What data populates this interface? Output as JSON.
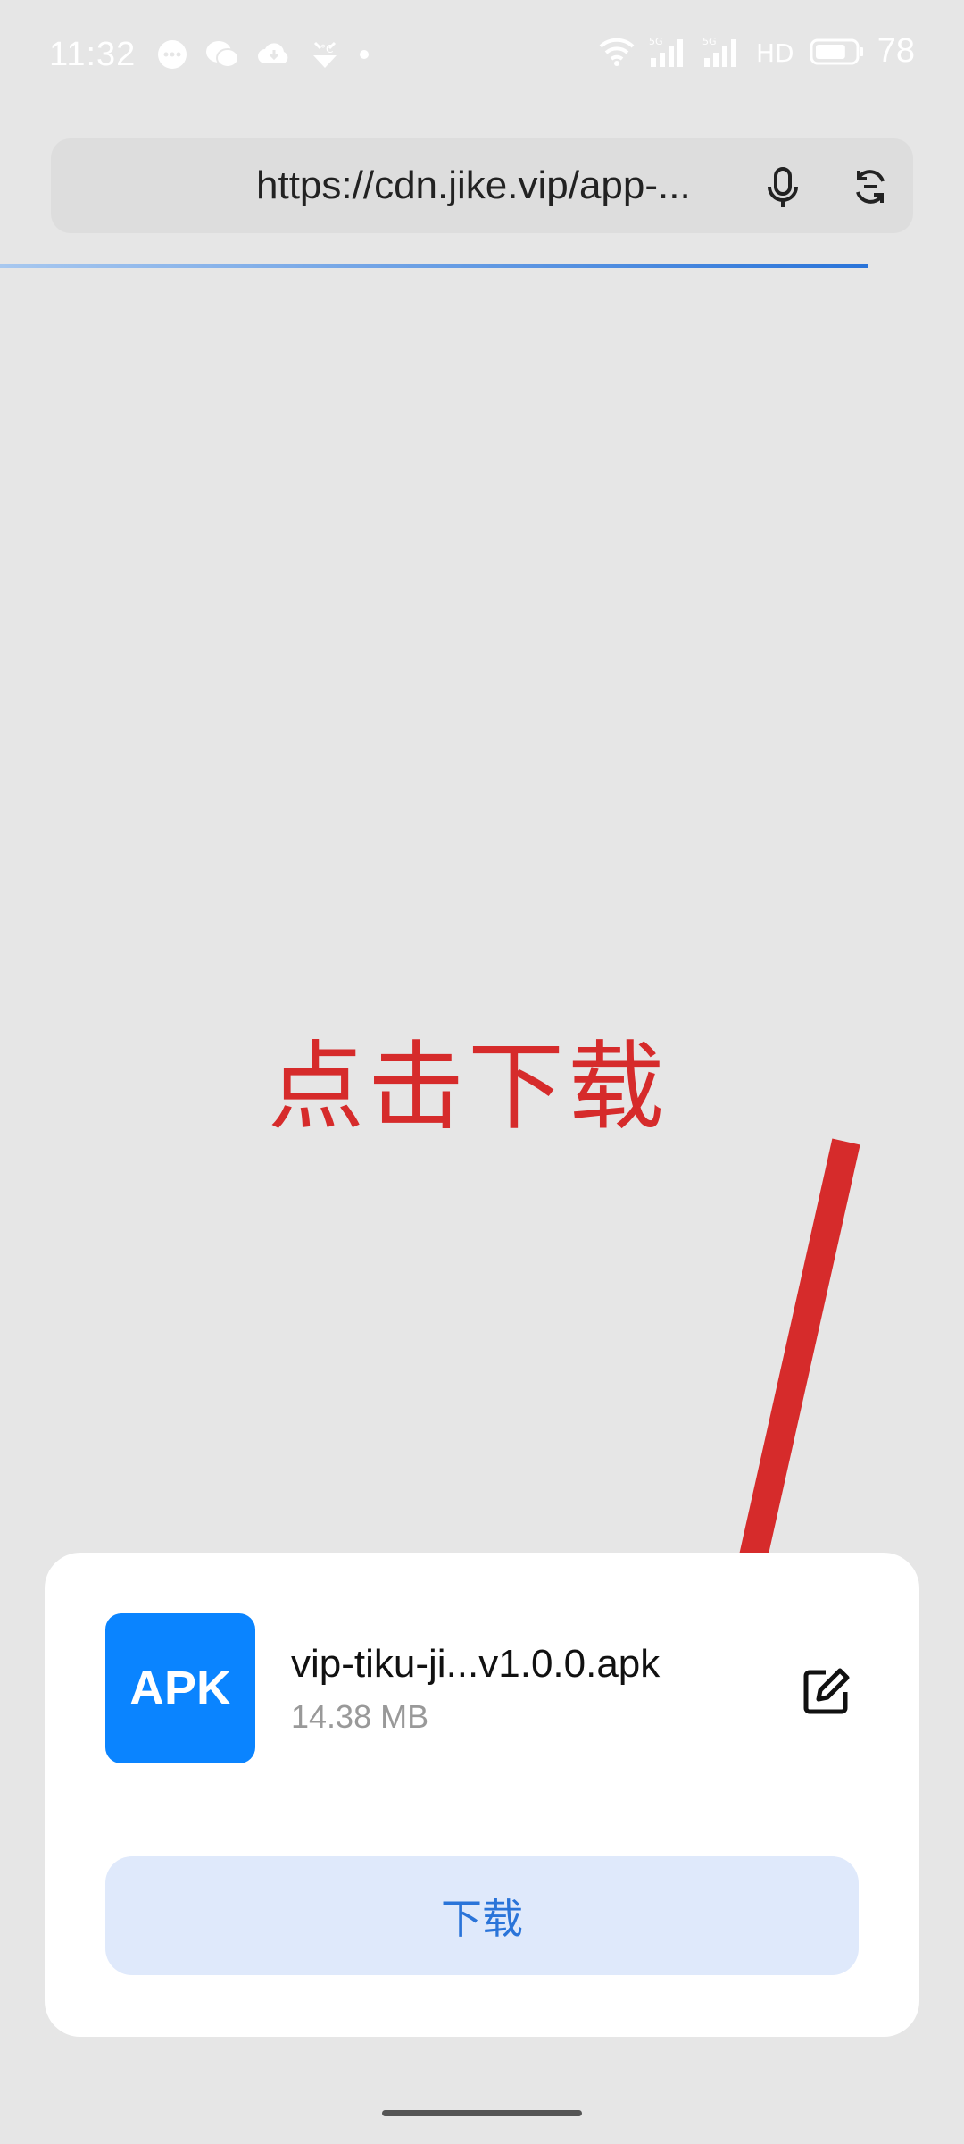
{
  "status_bar": {
    "time": "11:32",
    "left_icons": [
      "message-icon",
      "wechat-icon",
      "cloud-icon",
      "weather-icon",
      "dot-icon"
    ],
    "right_icons": [
      "wifi-icon",
      "signal-5g-icon",
      "signal-5g-icon",
      "hd-icon",
      "battery-icon"
    ],
    "network_label": "5G",
    "hd_label": "HD",
    "battery_level": "78",
    "battery_fraction": 0.78
  },
  "browser": {
    "url": "https://cdn.jike.vip/app-...",
    "mic_icon": "microphone-icon",
    "sync_icon": "sync-icon",
    "load_progress": 0.9
  },
  "annotation": {
    "text": "点击下载",
    "color": "#d62b2b"
  },
  "download_sheet": {
    "file_icon_label": "APK",
    "file_name": "vip-tiku-ji...v1.0.0.apk",
    "file_size": "14.38 MB",
    "edit_icon": "edit-icon",
    "download_label": "下载"
  },
  "colors": {
    "accent": "#2a74d9",
    "apk_icon_bg": "#0a84ff",
    "button_bg": "#dfe9fb",
    "page_bg": "#e6e6e6"
  }
}
